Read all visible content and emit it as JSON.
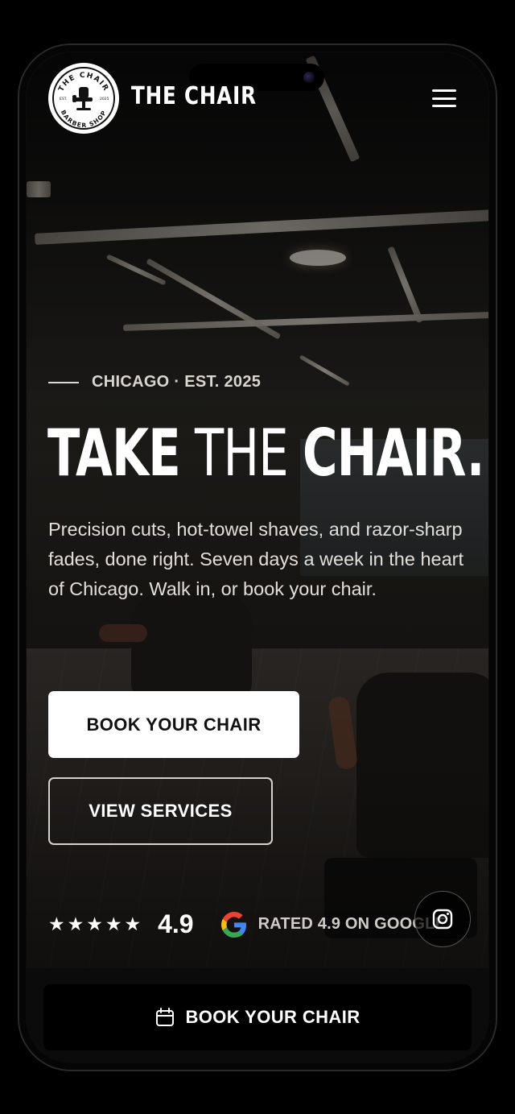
{
  "brand": {
    "name": "THE CHAIR",
    "logo_top_text": "THE CHAIR",
    "logo_bottom_text": "BARBER SHOP",
    "logo_left_text": "EST.",
    "logo_right_text": "2025"
  },
  "hero": {
    "eyebrow": "CHICAGO · EST. 2025",
    "headline_part1": "TAKE",
    "headline_part2": "THE",
    "headline_part3": "CHAIR.",
    "description": "Precision cuts, hot-towel shaves, and razor-sharp fades, done right. Seven days a week in the heart of Chicago. Walk in, or book your chair.",
    "primary_cta": "BOOK YOUR CHAIR",
    "secondary_cta": "VIEW SERVICES"
  },
  "rating": {
    "stars": "★★★★★",
    "stars_count": 5,
    "score": "4.9",
    "google_text": "RATED 4.9 ON GOOGLE"
  },
  "sticky": {
    "cta": "BOOK YOUR CHAIR"
  },
  "icons": [
    "menu-icon",
    "star-icon",
    "google-icon",
    "instagram-icon",
    "calendar-icon"
  ],
  "colors": {
    "background": "#000000",
    "primary_button_bg": "#ffffff",
    "primary_button_text": "#111111",
    "text": "#ffffff",
    "muted_text": "#d9d6d0"
  }
}
